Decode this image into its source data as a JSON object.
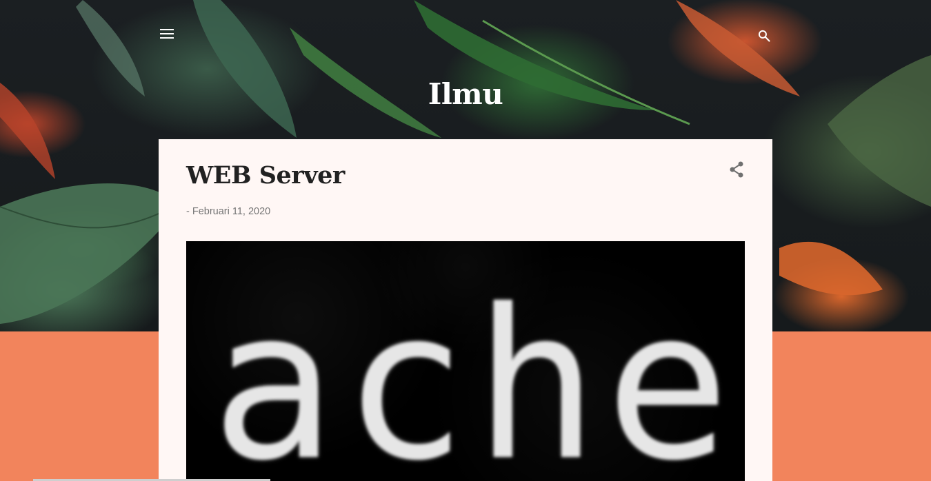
{
  "header": {
    "blog_title": "Ilmu",
    "menu_icon": "menu-icon",
    "search_icon": "search-icon"
  },
  "post": {
    "title": "WEB Server",
    "date": "- Februari 11, 2020",
    "share_icon": "share-icon",
    "image_text": "ache:"
  },
  "colors": {
    "accent": "#f2845c",
    "card": "#fff7f5",
    "title": "#212121",
    "date": "#757575"
  }
}
